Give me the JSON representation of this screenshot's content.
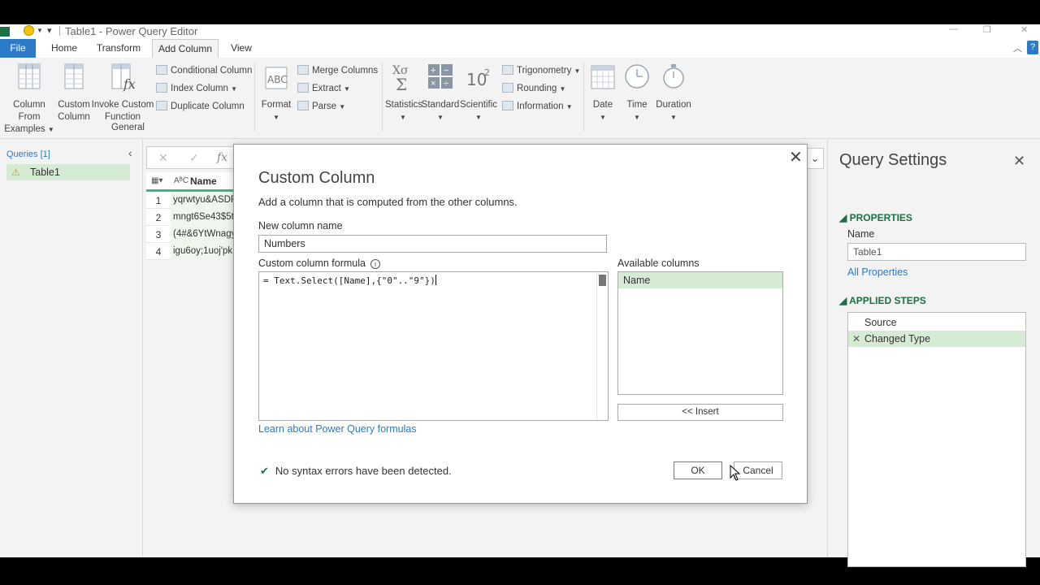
{
  "window": {
    "title": "Table1 - Power Query Editor"
  },
  "tabs": [
    {
      "label": "File"
    },
    {
      "label": "Home"
    },
    {
      "label": "Transform"
    },
    {
      "label": "Add Column"
    },
    {
      "label": "View"
    }
  ],
  "ribbon": {
    "column_from_examples": "Column From\nExamples",
    "column_from_examples_l1": "Column From",
    "column_from_examples_l2": "Examples",
    "custom_column_l1": "Custom",
    "custom_column_l2": "Column",
    "invoke_l1": "Invoke Custom",
    "invoke_l2": "Function",
    "conditional_column": "Conditional Column",
    "index_column": "Index Column",
    "duplicate_column": "Duplicate Column",
    "group_general": "General",
    "format": "Format",
    "merge_columns": "Merge Columns",
    "extract": "Extract",
    "parse": "Parse",
    "statistics": "Statistics",
    "standard": "Standard",
    "scientific": "Scientific",
    "trigonometry": "Trigonometry",
    "rounding": "Rounding",
    "information": "Information",
    "date": "Date",
    "time": "Time",
    "duration": "Duration"
  },
  "queries": {
    "header": "Queries [1]",
    "items": [
      {
        "label": "Table1"
      }
    ]
  },
  "grid": {
    "column_name": "Name",
    "rows": [
      {
        "n": "1",
        "value": "yqrwtyu&ASDF"
      },
      {
        "n": "2",
        "value": "mngt6Se43$5t"
      },
      {
        "n": "3",
        "value": "(4#&6YtWnagy"
      },
      {
        "n": "4",
        "value": "igu6oy;1uoj'pk"
      }
    ]
  },
  "settings": {
    "title": "Query Settings",
    "properties_label": "PROPERTIES",
    "name_label": "Name",
    "name_value": "Table1",
    "all_properties": "All Properties",
    "applied_steps_label": "APPLIED STEPS",
    "steps": [
      {
        "label": "Source"
      },
      {
        "label": "Changed Type"
      }
    ]
  },
  "dialog": {
    "title": "Custom Column",
    "description": "Add a column that is computed from the other columns.",
    "new_column_label": "New column name",
    "new_column_value": "Numbers",
    "formula_label": "Custom column formula",
    "formula": "= Text.Select([Name],{\"0\"..\"9\"})",
    "available_label": "Available columns",
    "available_columns": [
      {
        "label": "Name"
      }
    ],
    "insert_button": "<< Insert",
    "learn_link": "Learn about Power Query formulas",
    "status": "No syntax errors have been detected.",
    "ok": "OK",
    "cancel": "Cancel"
  },
  "colors": {
    "accent": "#2b7bc6",
    "excel_green": "#1d7044",
    "selection": "#d6ebd4"
  }
}
